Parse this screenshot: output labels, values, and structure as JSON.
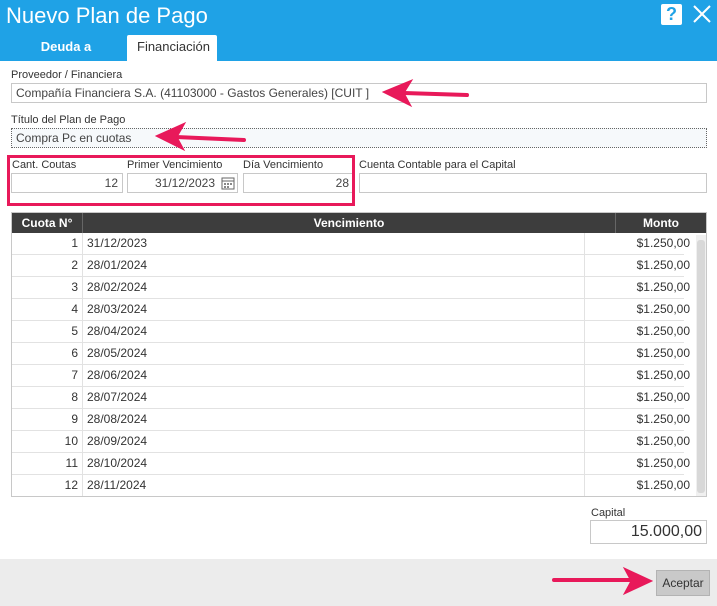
{
  "window": {
    "title": "Nuevo Plan de Pago",
    "help_label": "?"
  },
  "tabs": [
    {
      "label": "Deuda a Cancelar"
    },
    {
      "label": "Financiación"
    }
  ],
  "form": {
    "proveedor_label": "Proveedor / Financiera",
    "proveedor_value": "Compañía Financiera S.A. (41103000 - Gastos Generales) [CUIT ]",
    "titulo_label": "Título del Plan de Pago",
    "titulo_value": "Compra Pc en cuotas",
    "cant_cuotas_label": "Cant. Coutas",
    "cant_cuotas_value": "12",
    "primer_venc_label": "Primer Vencimiento",
    "primer_venc_value": "31/12/2023",
    "dia_venc_label": "Día Vencimiento",
    "dia_venc_value": "28",
    "cuenta_label": "Cuenta Contable para el Capital",
    "cuenta_value": ""
  },
  "table": {
    "headers": [
      "Cuota N°",
      "Vencimiento",
      "Monto"
    ],
    "rows": [
      {
        "n": "1",
        "date": "31/12/2023",
        "amount": "$1.250,00"
      },
      {
        "n": "2",
        "date": "28/01/2024",
        "amount": "$1.250,00"
      },
      {
        "n": "3",
        "date": "28/02/2024",
        "amount": "$1.250,00"
      },
      {
        "n": "4",
        "date": "28/03/2024",
        "amount": "$1.250,00"
      },
      {
        "n": "5",
        "date": "28/04/2024",
        "amount": "$1.250,00"
      },
      {
        "n": "6",
        "date": "28/05/2024",
        "amount": "$1.250,00"
      },
      {
        "n": "7",
        "date": "28/06/2024",
        "amount": "$1.250,00"
      },
      {
        "n": "8",
        "date": "28/07/2024",
        "amount": "$1.250,00"
      },
      {
        "n": "9",
        "date": "28/08/2024",
        "amount": "$1.250,00"
      },
      {
        "n": "10",
        "date": "28/09/2024",
        "amount": "$1.250,00"
      },
      {
        "n": "11",
        "date": "28/10/2024",
        "amount": "$1.250,00"
      },
      {
        "n": "12",
        "date": "28/11/2024",
        "amount": "$1.250,00"
      }
    ]
  },
  "capital": {
    "label": "Capital",
    "value": "15.000,00"
  },
  "footer": {
    "accept_label": "Aceptar"
  },
  "colors": {
    "titlebar": "#1fa2e6",
    "highlight": "#e8195a",
    "table_header": "#3d3d3d"
  },
  "icons": [
    "help-icon",
    "close-icon",
    "calendar-icon",
    "annotation-arrow"
  ]
}
